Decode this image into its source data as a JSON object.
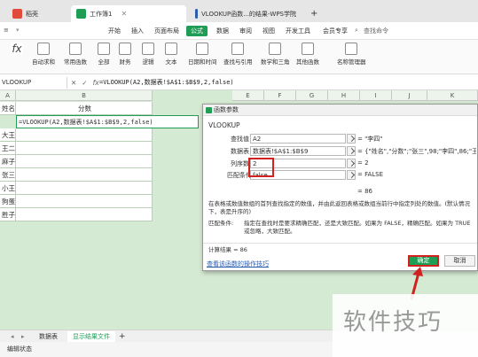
{
  "tabs": {
    "items": [
      {
        "label": "稻壳",
        "color": "#e24b3b"
      },
      {
        "label": "工作簿1",
        "color": "#1f9d55"
      },
      {
        "label": "VLOOKUP函数...的结果-WPS学院",
        "color": "#2a5db0"
      }
    ],
    "new_tab": "+"
  },
  "menu": [
    "开始",
    "插入",
    "页面布局",
    "公式",
    "数据",
    "审阅",
    "视图",
    "开发工具",
    "会员专享"
  ],
  "menu_active": "公式",
  "search_label": "查找命令",
  "ribbon": [
    "自动求和",
    "常用函数",
    "全部",
    "财务",
    "逻辑",
    "文本",
    "日期和时间",
    "查找与引用",
    "数学和三角",
    "其他函数",
    "名称管理器"
  ],
  "formula_bar": {
    "name_box": "VLOOKUP",
    "icons": [
      "✕",
      "✓",
      "fx"
    ],
    "formula": "=VLOOKUP(A2,数据表!$A$1:$B$9,2,false)"
  },
  "sheet": {
    "col_a": "A",
    "col_b": "B",
    "header_a": "姓名",
    "header_b": "分数",
    "editing_formula": "=VLOOKUP(A2,数据表!$A$1:$B$9,2,false)",
    "names": [
      "大王",
      "王二",
      "麻子",
      "张三",
      "小王",
      "狗蛋",
      "胜子"
    ],
    "other_cols": [
      "E",
      "F",
      "G",
      "H",
      "I",
      "J",
      "K"
    ]
  },
  "dialog": {
    "title": "函数参数",
    "function_name": "VLOOKUP",
    "params": [
      {
        "label": "查找值",
        "value": "A2",
        "result": "= \"李四\""
      },
      {
        "label": "数据表",
        "value": "数据表!$A$1:$B$9",
        "result": "= {\"姓名\",\"分数\";\"张三\",98;\"李四\",86;\"王二..."
      },
      {
        "label": "列序数",
        "value": "2",
        "result": "= 2"
      },
      {
        "label": "匹配条件",
        "value": "false",
        "result": "= FALSE"
      }
    ],
    "summary_result": "= 86",
    "description": "在表格或数值数组的首列查找指定的数值，并由此返回表格或数组当前行中指定列处的数值。(默认情况下，表是升序的)",
    "param_help_label": "匹配条件:",
    "param_help": "指定在查找时是要求精确匹配，还是大致匹配。如果为 FALSE，精确匹配。如果为 TRUE 或忽略，大致匹配。",
    "calc_result": "计算结果 = 86",
    "help_link": "查看该函数的操作技巧",
    "ok": "确定",
    "cancel": "取消"
  },
  "sheet_tabs": [
    "数据表",
    "显示结果文件"
  ],
  "sheet_add": "+",
  "status": "编辑状态",
  "watermark": "软件技巧",
  "colors": {
    "accent": "#1f9d55",
    "highlight": "#d02020",
    "grid": "#d5ead3"
  }
}
